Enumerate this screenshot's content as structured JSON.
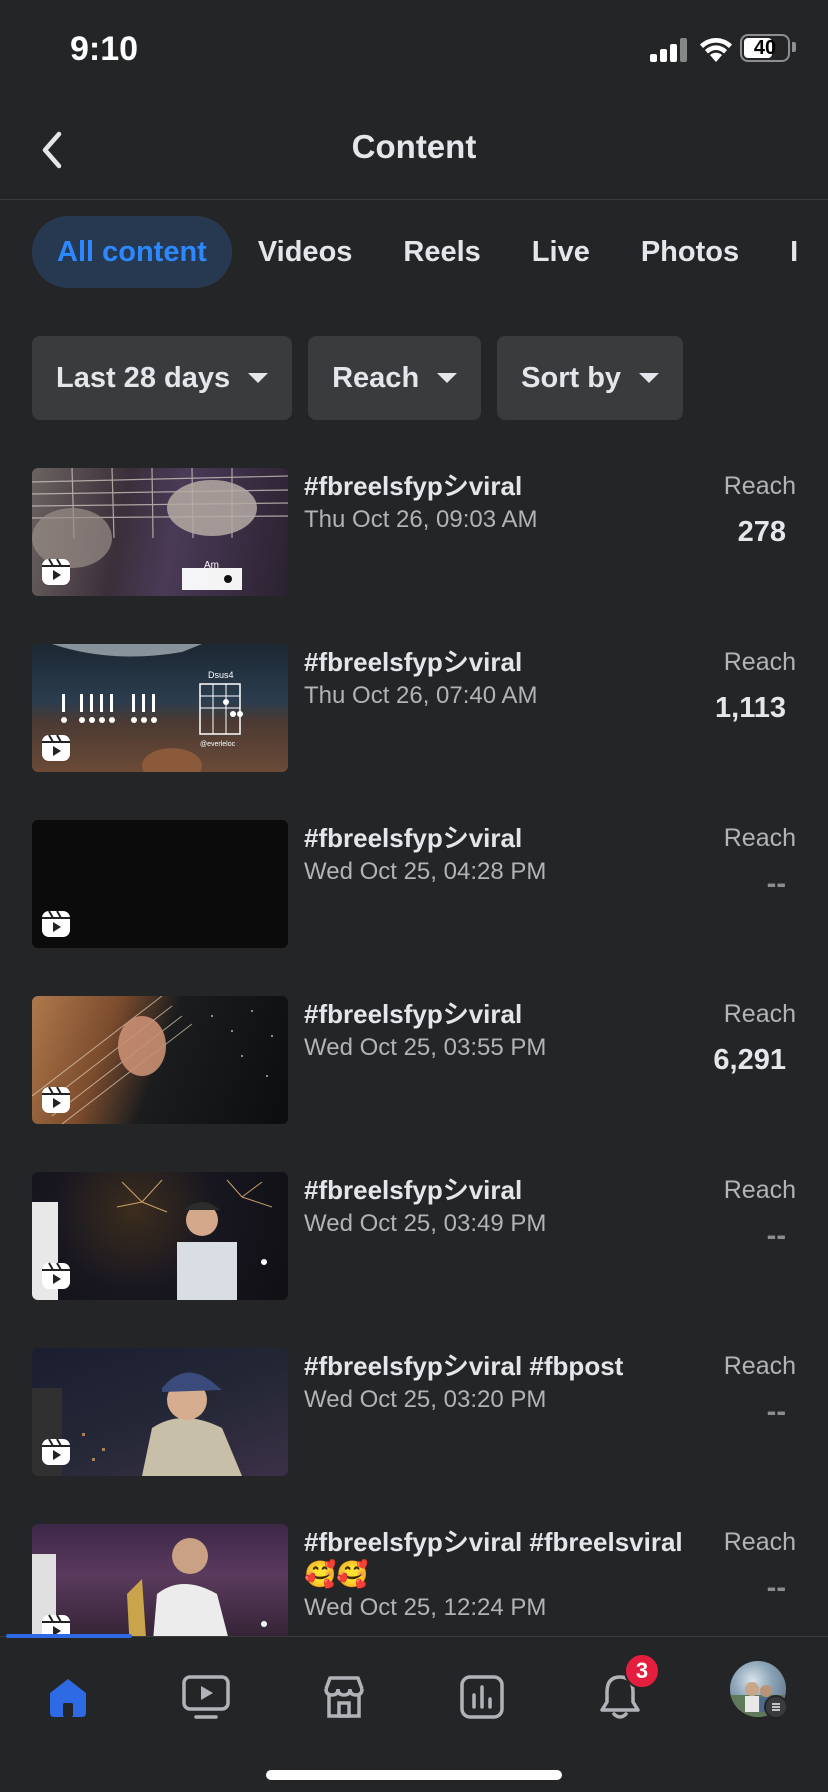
{
  "status_bar": {
    "time": "9:10",
    "battery": "40"
  },
  "header": {
    "title": "Content"
  },
  "tabs": [
    {
      "label": "All content",
      "active": true
    },
    {
      "label": "Videos"
    },
    {
      "label": "Reels"
    },
    {
      "label": "Live"
    },
    {
      "label": "Photos"
    },
    {
      "label": "I"
    }
  ],
  "filters": {
    "date_range": "Last 28 days",
    "metric": "Reach",
    "sort": "Sort by"
  },
  "items": [
    {
      "title": "#fbreelsfypシviral",
      "date": "Thu Oct 26, 09:03 AM",
      "reach_label": "Reach",
      "reach": "278"
    },
    {
      "title": "#fbreelsfypシviral",
      "date": "Thu Oct 26, 07:40 AM",
      "reach_label": "Reach",
      "reach": "1,113"
    },
    {
      "title": "#fbreelsfypシviral",
      "date": "Wed Oct 25, 04:28 PM",
      "reach_label": "Reach",
      "reach": "--"
    },
    {
      "title": "#fbreelsfypシviral",
      "date": "Wed Oct 25, 03:55 PM",
      "reach_label": "Reach",
      "reach": "6,291"
    },
    {
      "title": "#fbreelsfypシviral",
      "date": "Wed Oct 25, 03:49 PM",
      "reach_label": "Reach",
      "reach": "--"
    },
    {
      "title": "#fbreelsfypシviral  #fbpost",
      "date": "Wed Oct 25, 03:20 PM",
      "reach_label": "Reach",
      "reach": "--"
    },
    {
      "title": "#fbreelsfypシviral #fbreelsviral 🥰🥰",
      "date": "Wed Oct 25, 12:24 PM",
      "reach_label": "Reach",
      "reach": "--"
    }
  ],
  "thumbnail_text": {
    "chord_1": "Am",
    "chord_2": "Dsus4",
    "watermark_2": "@everleloc"
  },
  "bottom_nav": {
    "items": [
      "home",
      "video",
      "marketplace",
      "insights",
      "notifications",
      "profile"
    ],
    "notification_count": "3"
  },
  "colors": {
    "background": "#242526",
    "accent": "#2d88ff",
    "active_tab_bg": "#263951",
    "badge": "#e41e3f"
  }
}
